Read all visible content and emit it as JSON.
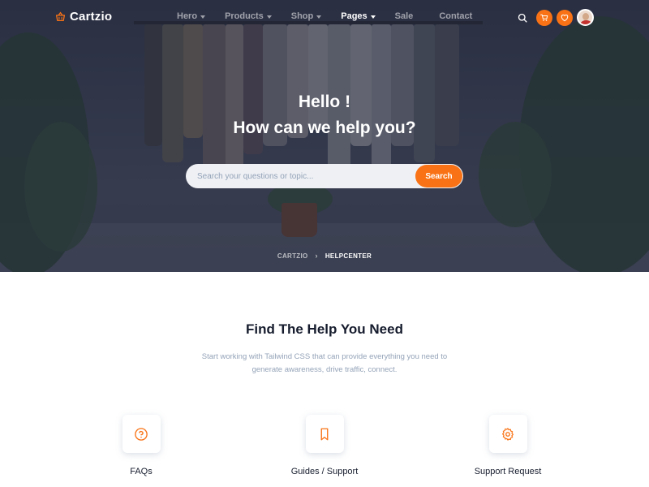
{
  "nav": {
    "brand": "Cartzio",
    "items": [
      {
        "label": "Hero",
        "dropdown": true,
        "active": false
      },
      {
        "label": "Products",
        "dropdown": true,
        "active": false
      },
      {
        "label": "Shop",
        "dropdown": true,
        "active": false
      },
      {
        "label": "Pages",
        "dropdown": true,
        "active": true
      },
      {
        "label": "Sale",
        "dropdown": false,
        "active": false
      },
      {
        "label": "Contact",
        "dropdown": false,
        "active": false
      }
    ],
    "icons": [
      "search-icon",
      "cart-icon",
      "heart-icon",
      "avatar"
    ]
  },
  "hero": {
    "title_line1": "Hello !",
    "title_line2": "How can we help you?",
    "search": {
      "placeholder": "Search your questions or topic...",
      "value": "",
      "button_label": "Search"
    },
    "breadcrumb": {
      "parent": "CARTZIO",
      "current": "HELPCENTER"
    }
  },
  "section": {
    "title": "Find The Help You Need",
    "description": "Start working with Tailwind CSS that can provide everything you need to generate awareness, drive traffic, connect."
  },
  "features": [
    {
      "label": "FAQs",
      "icon": "help-circle-icon"
    },
    {
      "label": "Guides / Support",
      "icon": "bookmark-icon"
    },
    {
      "label": "Support Request",
      "icon": "settings-icon"
    }
  ],
  "colors": {
    "accent": "#f97316",
    "text_dark": "#161c2d",
    "text_muted": "#94a3b8"
  }
}
